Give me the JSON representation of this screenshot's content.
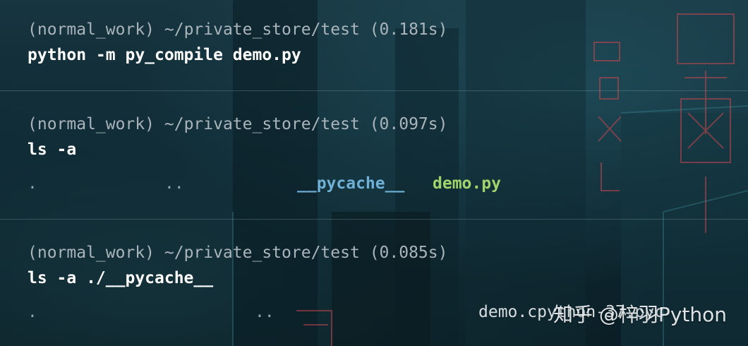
{
  "blocks": [
    {
      "prompt": {
        "env": "(normal_work)",
        "path": "~/private_store/test",
        "time": "(0.181s)"
      },
      "command": "python -m py_compile demo.py",
      "output": []
    },
    {
      "prompt": {
        "env": "(normal_work)",
        "path": "~/private_store/test",
        "time": "(0.097s)"
      },
      "command": "ls -a",
      "output": [
        {
          "name": ".",
          "kind": "dot"
        },
        {
          "name": "..",
          "kind": "dot"
        },
        {
          "name": "__pycache__",
          "kind": "directory"
        },
        {
          "name": "demo.py",
          "kind": "python-file"
        }
      ]
    },
    {
      "prompt": {
        "env": "(normal_work)",
        "path": "~/private_store/test",
        "time": "(0.085s)"
      },
      "command": "ls -a ./__pycache__",
      "output": [
        {
          "name": ".",
          "kind": "dot"
        },
        {
          "name": "..",
          "kind": "dot"
        },
        {
          "name": "demo.cpython-37.pyc",
          "kind": "file"
        }
      ]
    }
  ],
  "watermark": "知乎 @梓羽Python",
  "colors": {
    "background": "#0b1f27",
    "prompt": "#a9b5bb",
    "command": "#ffffff",
    "directory": "#6fb0d6",
    "python_file": "#9fd36b",
    "dot": "#8ea7b5",
    "neon_sign": "#c8464e"
  }
}
